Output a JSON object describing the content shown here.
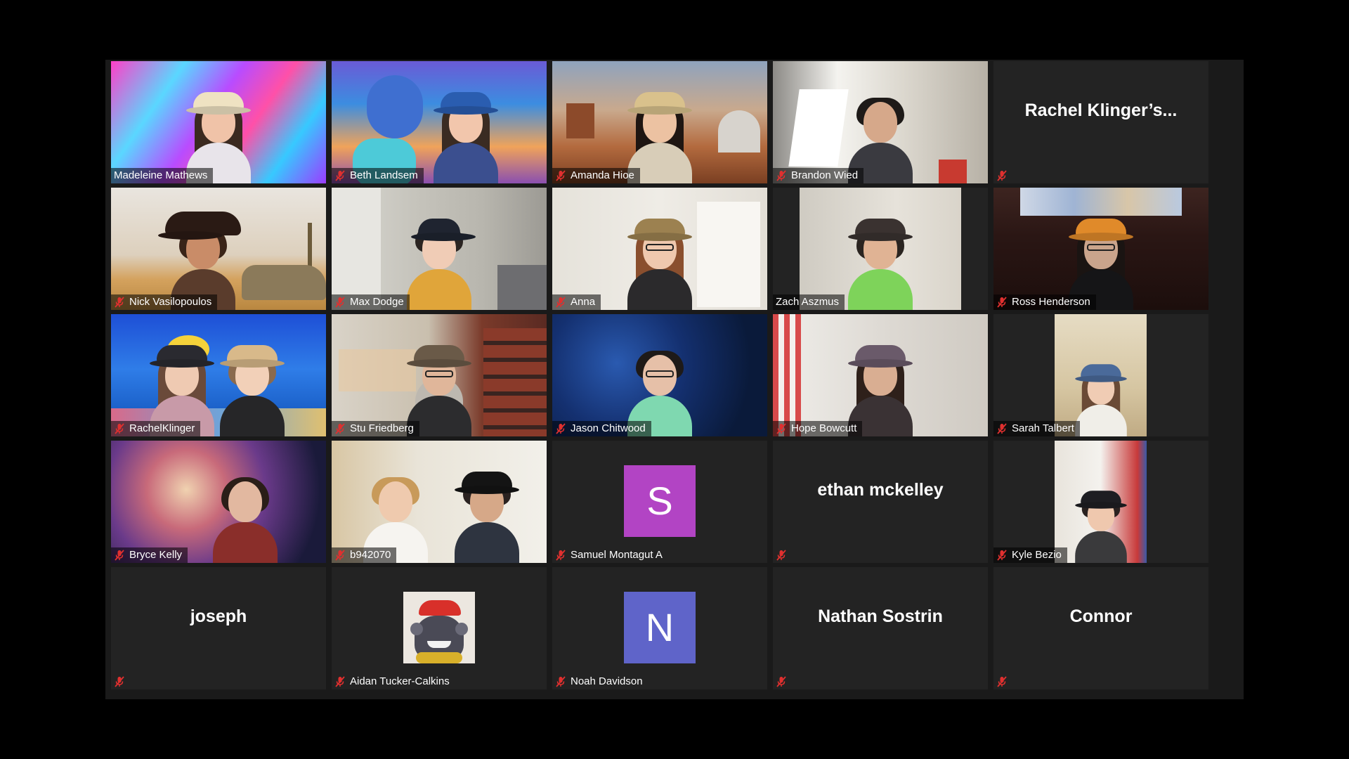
{
  "app": {
    "colors": {
      "background": "#000000",
      "window": "#1a1a1a",
      "tile": "#232323",
      "muted_icon": "#e0302f",
      "avatar_s": "#b244c4",
      "avatar_n": "#5f64c9"
    }
  },
  "participants": [
    {
      "name": "Madeleine Mathews",
      "muted": false,
      "kind": "video"
    },
    {
      "name": "Beth Landsem",
      "muted": true,
      "kind": "video"
    },
    {
      "name": "Amanda Hioe",
      "muted": true,
      "kind": "video"
    },
    {
      "name": "Brandon Wied",
      "muted": true,
      "kind": "video"
    },
    {
      "name": "Rachel  Klinger’s...",
      "muted": true,
      "kind": "name-only"
    },
    {
      "name": "Nick Vasilopoulos",
      "muted": true,
      "kind": "video"
    },
    {
      "name": "Max Dodge",
      "muted": true,
      "kind": "video"
    },
    {
      "name": "Anna",
      "muted": true,
      "kind": "video"
    },
    {
      "name": "Zach Aszmus",
      "muted": false,
      "kind": "video"
    },
    {
      "name": "Ross Henderson",
      "muted": true,
      "kind": "video"
    },
    {
      "name": "RachelKlinger",
      "muted": true,
      "kind": "video"
    },
    {
      "name": "Stu Friedberg",
      "muted": true,
      "kind": "video"
    },
    {
      "name": "Jason Chitwood",
      "muted": true,
      "kind": "video"
    },
    {
      "name": "Hope Bowcutt",
      "muted": true,
      "kind": "video"
    },
    {
      "name": "Sarah Talbert",
      "muted": true,
      "kind": "video"
    },
    {
      "name": "Bryce Kelly",
      "muted": true,
      "kind": "video"
    },
    {
      "name": "b942070",
      "muted": true,
      "kind": "video"
    },
    {
      "name": "Samuel Montagut A",
      "muted": true,
      "kind": "initial",
      "initial": "S"
    },
    {
      "name": "ethan mckelley",
      "muted": true,
      "kind": "name-only"
    },
    {
      "name": "Kyle Bezio",
      "muted": true,
      "kind": "video"
    },
    {
      "name": "joseph",
      "muted": true,
      "kind": "name-only"
    },
    {
      "name": "Aidan Tucker-Calkins",
      "muted": true,
      "kind": "picture"
    },
    {
      "name": "Noah Davidson",
      "muted": true,
      "kind": "initial",
      "initial": "N"
    },
    {
      "name": "Nathan Sostrin",
      "muted": true,
      "kind": "name-only"
    },
    {
      "name": "Connor",
      "muted": true,
      "kind": "name-only"
    }
  ]
}
